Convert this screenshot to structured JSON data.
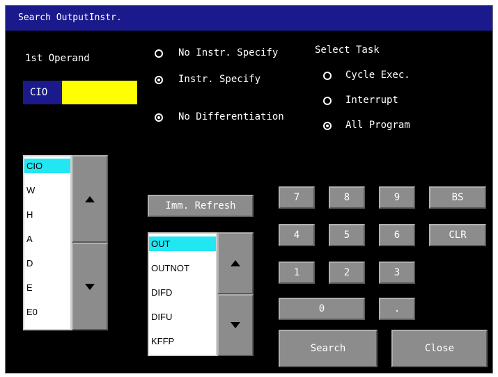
{
  "window": {
    "title": "Search OutputInstr."
  },
  "operand": {
    "label": "1st Operand",
    "area_label": "CIO",
    "value": "",
    "value_color": "#ffff00"
  },
  "instr_mode": {
    "options": [
      {
        "label": "No Instr. Specify",
        "selected": false
      },
      {
        "label": "Instr. Specify",
        "selected": true
      }
    ]
  },
  "differentiation": {
    "label": "No Differentiation",
    "selected": true
  },
  "task": {
    "title": "Select Task",
    "options": [
      {
        "label": "Cycle Exec.",
        "selected": false
      },
      {
        "label": "Interrupt",
        "selected": false
      },
      {
        "label": "All Program",
        "selected": true
      }
    ]
  },
  "area_list": {
    "items": [
      "CIO",
      "W",
      "H",
      "A",
      "D",
      "E",
      "E0"
    ],
    "selected": "CIO",
    "highlight_color": "#22e6f2"
  },
  "imm_refresh_label": "Imm. Refresh",
  "instr_list": {
    "items": [
      "OUT",
      "OUTNOT",
      "DIFD",
      "DIFU",
      "KFFP"
    ],
    "selected": "OUT"
  },
  "keypad": {
    "keys": [
      "7",
      "8",
      "9",
      "BS",
      "4",
      "5",
      "6",
      "CLR",
      "1",
      "2",
      "3",
      "0",
      "."
    ]
  },
  "actions": {
    "search_label": "Search",
    "close_label": "Close"
  },
  "colors": {
    "title_bar": "#1a1a8c",
    "background": "#000000",
    "button": "#8c8c8c"
  }
}
